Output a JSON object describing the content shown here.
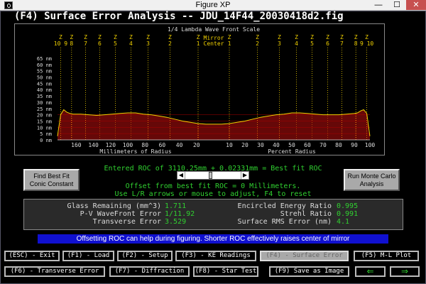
{
  "window": {
    "title": "Figure XP",
    "min": "—",
    "max": "☐",
    "close": "✕"
  },
  "main_title": "(F4) Surface Error Analysis -- JDU_14F44_20030418d2.fig",
  "chart_data": {
    "type": "bar",
    "title": "1/4 Lambda Wave Front Scale",
    "center_label": [
      "Mirror",
      "Center"
    ],
    "ylim": [
      0,
      65
    ],
    "y_ticks": [
      "65 nm",
      "60 nm",
      "55 nm",
      "50 nm",
      "45 nm",
      "40 nm",
      "35 nm",
      "30 nm",
      "25 nm",
      "20 nm",
      "15 nm",
      "10 nm",
      "5 nm",
      "0 nm"
    ],
    "left_xlabel": "Millimeters of Radius",
    "left_x_ticks": [
      "160",
      "140",
      "120",
      "100",
      "80",
      "60",
      "40",
      "20"
    ],
    "right_xlabel": "Percent Radius",
    "right_x_ticks": [
      "10",
      "20",
      "30",
      "40",
      "50",
      "60",
      "70",
      "80",
      "90",
      "100"
    ],
    "zone_labels_left": [
      "10 9",
      "8",
      "7",
      "6",
      "5",
      "4",
      "3",
      "2",
      "1"
    ],
    "zone_labels_right": [
      "1",
      "2",
      "3",
      "4",
      "5",
      "6",
      "7",
      "8",
      "9 10"
    ],
    "zone_prefix": "Z",
    "colors": {
      "bars": "#cc1111",
      "curve": "#f0d000",
      "zones": "#f0d000"
    },
    "curve": [
      [
        -100,
        3
      ],
      [
        -98,
        20
      ],
      [
        -96,
        24
      ],
      [
        -94,
        22
      ],
      [
        -92,
        21
      ],
      [
        -90,
        20.5
      ],
      [
        -85,
        20.5
      ],
      [
        -80,
        20
      ],
      [
        -75,
        19.5
      ],
      [
        -70,
        20
      ],
      [
        -65,
        20.5
      ],
      [
        -60,
        21
      ],
      [
        -55,
        21.5
      ],
      [
        -50,
        21.5
      ],
      [
        -45,
        20.5
      ],
      [
        -40,
        20
      ],
      [
        -35,
        19
      ],
      [
        -30,
        18
      ],
      [
        -25,
        16.5
      ],
      [
        -20,
        15
      ],
      [
        -15,
        14
      ],
      [
        -10,
        13
      ],
      [
        -5,
        12.5
      ],
      [
        0,
        12.5
      ],
      [
        5,
        12.5
      ],
      [
        10,
        13
      ],
      [
        15,
        14
      ],
      [
        20,
        15
      ],
      [
        25,
        16.5
      ],
      [
        30,
        18
      ],
      [
        35,
        19
      ],
      [
        40,
        20
      ],
      [
        45,
        20.5
      ],
      [
        50,
        21.5
      ],
      [
        55,
        21.5
      ],
      [
        60,
        21
      ],
      [
        65,
        20.5
      ],
      [
        70,
        20
      ],
      [
        75,
        20
      ],
      [
        80,
        20
      ],
      [
        85,
        20.5
      ],
      [
        90,
        21
      ],
      [
        92,
        21.5
      ],
      [
        94,
        23
      ],
      [
        96,
        24
      ],
      [
        98,
        21
      ],
      [
        100,
        3
      ]
    ]
  },
  "roc": {
    "line1": "Entered ROC of 3110.25mm + 0.02331mm = Best fit ROC",
    "line2": "Offset from best fit ROC = 0 Millimeters.",
    "line3": "Use L/R arrows or mouse to adjust, F4 to reset",
    "slider_position": 0.45
  },
  "buttons": {
    "conic": "Find Best Fit Conic Constant",
    "monte": "Run Monte Carlo Analysis"
  },
  "stats": {
    "glass_label": "Glass Remaining (mm^3)",
    "glass_value": "1.711",
    "pv_label": "P-V WaveFront Error",
    "pv_value": "1/11.92",
    "trans_label": "Transverse Error",
    "trans_value": "3.529",
    "energy_label": "Encircled Energy Ratio",
    "energy_value": "0.995",
    "strehl_label": "Strehl Ratio",
    "strehl_value": "0.991",
    "rms_label": "Surface RMS Error (nm)",
    "rms_value": "4.1"
  },
  "info": "Offsetting ROC can help during figuring. Shorter ROC effectively raises center of mirror",
  "nav": {
    "esc": "(ESC) - Exit",
    "f1": "(F1) - Load",
    "f2": "(F2) - Setup",
    "f3": "(F3) - KE Readings",
    "f4": "(F4) - Surface Error",
    "f5": "(F5) M-L Plot",
    "f6": "(F6) - Transverse Error",
    "f7": "(F7) - Diffraction",
    "f8": "(F8) - Star Test",
    "f9": "(F9) Save as Image",
    "prev": "⇐",
    "next": "⇒"
  }
}
